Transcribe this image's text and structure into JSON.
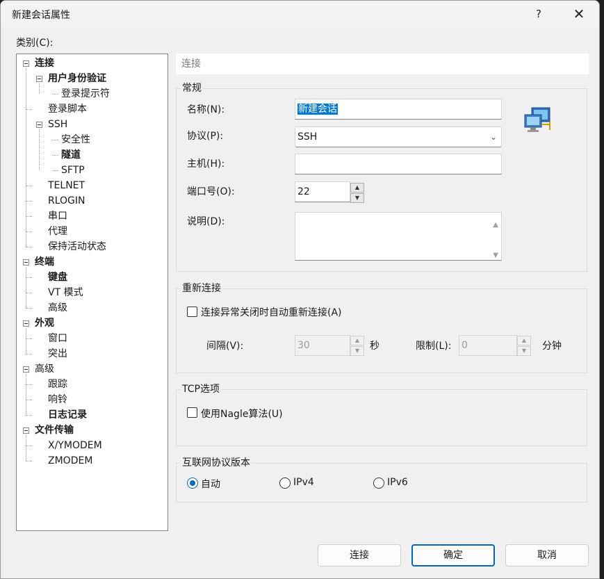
{
  "window": {
    "title": "新建会话属性",
    "help": "?",
    "close": "✕"
  },
  "category_label": "类别(C):",
  "tree": [
    {
      "label": "连接",
      "bold": true,
      "level": 0,
      "expander": true
    },
    {
      "label": "用户身份验证",
      "bold": true,
      "level": 1,
      "expander": true
    },
    {
      "label": "登录提示符",
      "bold": false,
      "level": 2,
      "expander": false
    },
    {
      "label": "登录脚本",
      "bold": false,
      "level": 1,
      "expander": false
    },
    {
      "label": "SSH",
      "bold": false,
      "level": 1,
      "expander": true
    },
    {
      "label": "安全性",
      "bold": false,
      "level": 2,
      "expander": false
    },
    {
      "label": "隧道",
      "bold": true,
      "level": 2,
      "expander": false
    },
    {
      "label": "SFTP",
      "bold": false,
      "level": 2,
      "expander": false
    },
    {
      "label": "TELNET",
      "bold": false,
      "level": 1,
      "expander": false
    },
    {
      "label": "RLOGIN",
      "bold": false,
      "level": 1,
      "expander": false
    },
    {
      "label": "串口",
      "bold": false,
      "level": 1,
      "expander": false
    },
    {
      "label": "代理",
      "bold": false,
      "level": 1,
      "expander": false
    },
    {
      "label": "保持活动状态",
      "bold": false,
      "level": 1,
      "expander": false
    },
    {
      "label": "终端",
      "bold": true,
      "level": 0,
      "expander": true
    },
    {
      "label": "键盘",
      "bold": true,
      "level": 1,
      "expander": false
    },
    {
      "label": "VT 模式",
      "bold": false,
      "level": 1,
      "expander": false
    },
    {
      "label": "高级",
      "bold": false,
      "level": 1,
      "expander": false
    },
    {
      "label": "外观",
      "bold": true,
      "level": 0,
      "expander": true
    },
    {
      "label": "窗口",
      "bold": false,
      "level": 1,
      "expander": false
    },
    {
      "label": "突出",
      "bold": false,
      "level": 1,
      "expander": false
    },
    {
      "label": "高级",
      "bold": false,
      "level": 0,
      "expander": true
    },
    {
      "label": "跟踪",
      "bold": false,
      "level": 1,
      "expander": false
    },
    {
      "label": "响铃",
      "bold": false,
      "level": 1,
      "expander": false
    },
    {
      "label": "日志记录",
      "bold": true,
      "level": 1,
      "expander": false
    },
    {
      "label": "文件传输",
      "bold": true,
      "level": 0,
      "expander": true
    },
    {
      "label": "X/YMODEM",
      "bold": false,
      "level": 1,
      "expander": false
    },
    {
      "label": "ZMODEM",
      "bold": false,
      "level": 1,
      "expander": false
    }
  ],
  "panel": {
    "header": "连接",
    "general": {
      "title": "常规",
      "name_label": "名称(N):",
      "name_value": "新建会话",
      "protocol_label": "协议(P):",
      "protocol_value": "SSH",
      "host_label": "主机(H):",
      "host_value": "",
      "port_label": "端口号(O):",
      "port_value": "22",
      "desc_label": "说明(D):",
      "desc_value": ""
    },
    "reconnect": {
      "title": "重新连接",
      "auto_label": "连接异常关闭时自动重新连接(A)",
      "auto_checked": false,
      "interval_label": "间隔(V):",
      "interval_value": "30",
      "interval_unit": "秒",
      "limit_label": "限制(L):",
      "limit_value": "0",
      "limit_unit": "分钟"
    },
    "tcp": {
      "title": "TCP选项",
      "nagle_label": "使用Nagle算法(U)",
      "nagle_checked": false
    },
    "ip": {
      "title": "互联网协议版本",
      "options": [
        "自动",
        "IPv4",
        "IPv6"
      ],
      "selected": "自动"
    }
  },
  "buttons": {
    "connect": "连接",
    "ok": "确定",
    "cancel": "取消"
  },
  "colors": {
    "accent": "#0067c0",
    "selection": "#0078d7"
  }
}
